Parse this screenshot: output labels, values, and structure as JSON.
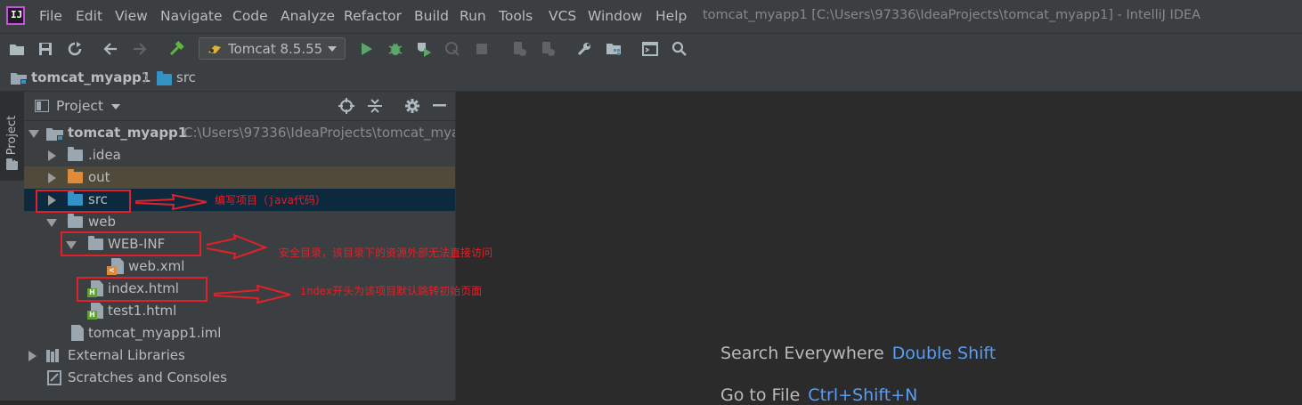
{
  "window": {
    "title": "tomcat_myapp1 [C:\\Users\\97336\\IdeaProjects\\tomcat_myapp1] - IntelliJ IDEA",
    "app_icon_label": "IJ"
  },
  "menu": [
    "File",
    "Edit",
    "View",
    "Navigate",
    "Code",
    "Analyze",
    "Refactor",
    "Build",
    "Run",
    "Tools",
    "VCS",
    "Window",
    "Help"
  ],
  "toolbar": {
    "run_config": "Tomcat 8.5.55"
  },
  "breadcrumbs": [
    "tomcat_myapp1",
    "src"
  ],
  "side_tab": {
    "label": "1: Project"
  },
  "project_panel": {
    "title": "Project",
    "tree": [
      {
        "label": "tomcat_myapp1",
        "path": "C:\\Users\\97336\\IdeaProjects\\tomcat_myap"
      },
      {
        "label": ".idea"
      },
      {
        "label": "out"
      },
      {
        "label": "src"
      },
      {
        "label": "web"
      },
      {
        "label": "WEB-INF"
      },
      {
        "label": "web.xml"
      },
      {
        "label": "index.html"
      },
      {
        "label": "test1.html"
      },
      {
        "label": "tomcat_myapp1.iml"
      },
      {
        "label": "External Libraries"
      },
      {
        "label": "Scratches and Consoles"
      }
    ]
  },
  "editor": {
    "hints": [
      {
        "label": "Search Everywhere",
        "shortcut": "Double Shift"
      },
      {
        "label": "Go to File",
        "shortcut": "Ctrl+Shift+N"
      }
    ]
  },
  "annotations": [
    "编写项目（java代码）",
    "安全目录，该目录下的资源外部无法直接访问",
    "index开头为该项目默认跳转初始页面"
  ],
  "colors": {
    "accent": "#589df6",
    "annotation": "#e0212a",
    "selected_row": "#0d293e",
    "excluded_row": "#4f4a3a"
  }
}
